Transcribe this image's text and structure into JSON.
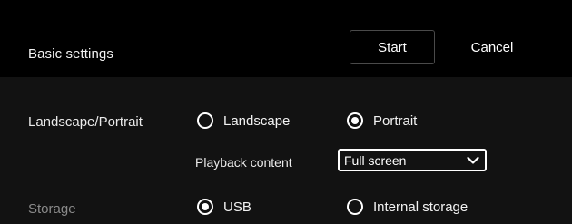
{
  "header": {
    "title": "Basic settings",
    "start_label": "Start",
    "cancel_label": "Cancel"
  },
  "orientation": {
    "label": "Landscape/Portrait",
    "options": [
      {
        "label": "Landscape",
        "selected": false
      },
      {
        "label": "Portrait",
        "selected": true
      }
    ]
  },
  "playback": {
    "label": "Playback content",
    "selected": "Full screen",
    "icon": "chevron-down-icon"
  },
  "storage": {
    "label": "Storage",
    "options": [
      {
        "label": "USB",
        "selected": true
      },
      {
        "label": "Internal storage",
        "selected": false
      }
    ]
  },
  "colors": {
    "background": "#121212",
    "header_background": "#000000",
    "text": "#ffffff",
    "disabled_text": "#8a8a8a"
  }
}
